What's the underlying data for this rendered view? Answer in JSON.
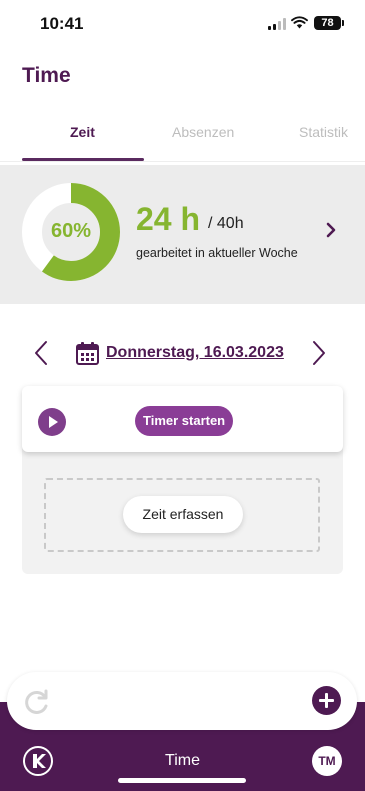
{
  "status_bar": {
    "time": "10:41",
    "battery": "78"
  },
  "header": {
    "title": "Time"
  },
  "tabs": [
    {
      "label": "Zeit",
      "active": true
    },
    {
      "label": "Absenzen",
      "active": false
    },
    {
      "label": "Statistik",
      "active": false
    }
  ],
  "summary": {
    "progress_percent": 60,
    "progress_label": "60%",
    "hours_worked": "24 h",
    "hours_target": "/ 40h",
    "caption": "gearbeitet in aktueller Woche"
  },
  "date_nav": {
    "date": "Donnerstag, 16.03.2023"
  },
  "timer": {
    "start_label": "Timer starten"
  },
  "entry": {
    "add_time_label": "Zeit erfassen"
  },
  "bottom_nav": {
    "title": "Time",
    "avatar_initials": "TM"
  },
  "colors": {
    "brand_purple": "#4e1a52",
    "accent_purple": "#8a3d96",
    "progress_green": "#86b530"
  },
  "icons": [
    "signal-icon",
    "wifi-icon",
    "battery-icon",
    "chevron-right-icon",
    "chevron-left-icon",
    "calendar-icon",
    "play-icon",
    "refresh-icon",
    "plus-icon",
    "app-logo-icon"
  ]
}
